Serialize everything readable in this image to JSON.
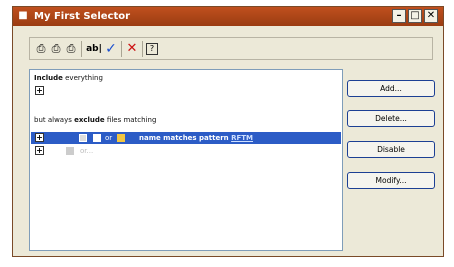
{
  "window": {
    "title": "My First Selector"
  },
  "titlebar_buttons": {
    "minimize": "–",
    "maximize": "□",
    "close": "✕"
  },
  "toolbar": {
    "items": [
      "⎙",
      "⎙",
      "⎙",
      "ab|",
      "✓",
      "✕",
      "?"
    ],
    "colors": {
      "check": "#1a4fcf",
      "x": "#cc1111"
    }
  },
  "list": {
    "include_text_bold": "Include",
    "include_text_rest": " everything",
    "exclude_prefix": "but always ",
    "exclude_bold": "exclude",
    "exclude_suffix": " files matching",
    "selected_or": "or",
    "selected_text": "name matches pattern",
    "selected_link": "RFTM",
    "second_or": "or..."
  },
  "buttons": {
    "add": "Add...",
    "delete": "Delete...",
    "disable": "Disable",
    "modify": "Modify..."
  },
  "colors": {
    "titlebar": "#b0461a",
    "selection": "#2c5cc6",
    "window_bg": "#ece9d8"
  }
}
